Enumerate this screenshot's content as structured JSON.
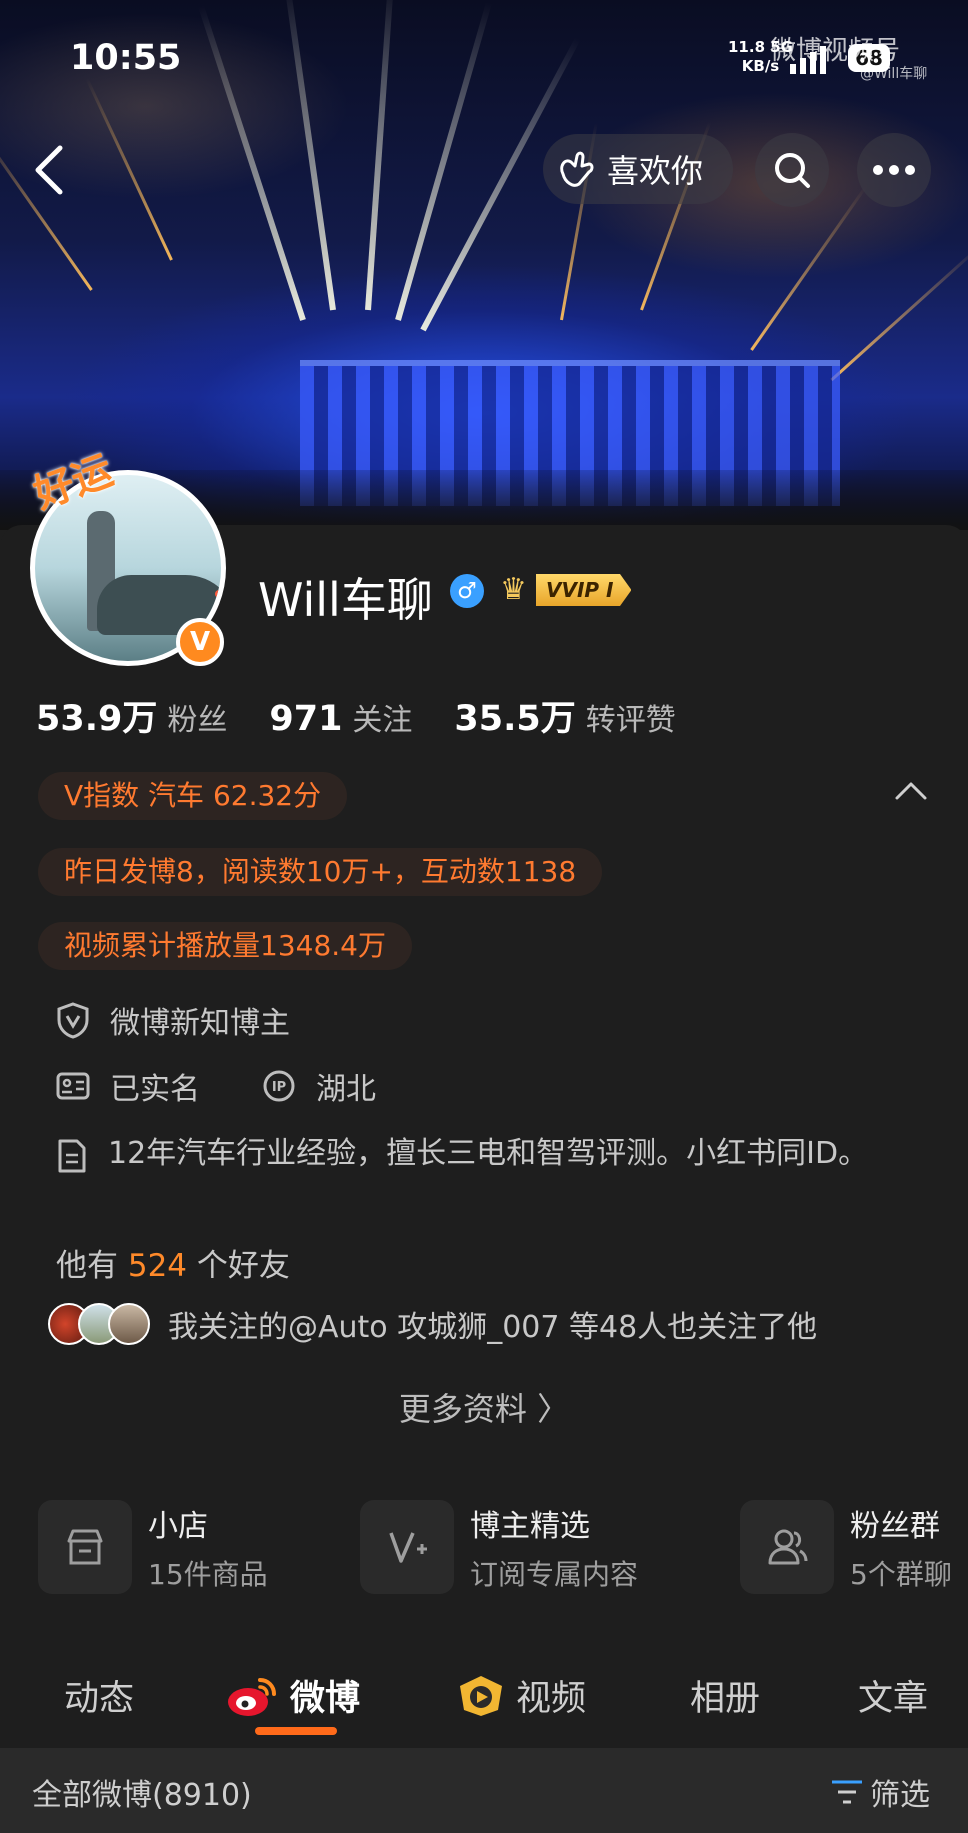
{
  "status_bar": {
    "time": "10:55",
    "net_speed": "11.8",
    "net_unit": "KB/s",
    "network": "5G",
    "battery": "68"
  },
  "watermark": {
    "text": "微博视频号",
    "sub": "@Will车聊"
  },
  "top_bar": {
    "like_label": "喜欢你"
  },
  "profile": {
    "badge_text": "好运",
    "verified_badge": "V",
    "username": "Will车聊",
    "gender_symbol": "♂",
    "vip_label": "VVIP I"
  },
  "stats": [
    {
      "value": "53.9万",
      "label": "粉丝"
    },
    {
      "value": "971",
      "label": "关注"
    },
    {
      "value": "35.5万",
      "label": "转评赞"
    }
  ],
  "highlights": {
    "v_index": "V指数 汽车 62.32分",
    "yesterday": "昨日发博8，阅读数10万+，互动数1138",
    "video_plays": "视频累计播放量1348.4万"
  },
  "info": {
    "title": "微博新知博主",
    "real_name": "已实名",
    "ip_location": "湖北",
    "bio": "12年汽车行业经验，擅长三电和智驾评测。小红书同ID。"
  },
  "friends": {
    "prefix": "他有",
    "count": "524",
    "suffix": "个好友",
    "mutual_text": "我关注的@Auto 攻城狮_007 等48人也关注了他"
  },
  "more_info": "更多资料 〉",
  "features": [
    {
      "title": "小店",
      "subtitle": "15件商品",
      "icon": "shop-icon"
    },
    {
      "title": "博主精选",
      "subtitle": "订阅专属内容",
      "icon": "v-plus-icon"
    },
    {
      "title": "粉丝群",
      "subtitle": "5个群聊",
      "icon": "group-icon"
    }
  ],
  "tabs": [
    "动态",
    "微博",
    "视频",
    "相册",
    "文章"
  ],
  "active_tab": "微博",
  "filter": {
    "label": "全部微博(8910)",
    "button": "筛选"
  },
  "colors": {
    "accent": "#ff6a1a",
    "highlight_text": "#ff7a30",
    "background": "#1e1e1e"
  }
}
